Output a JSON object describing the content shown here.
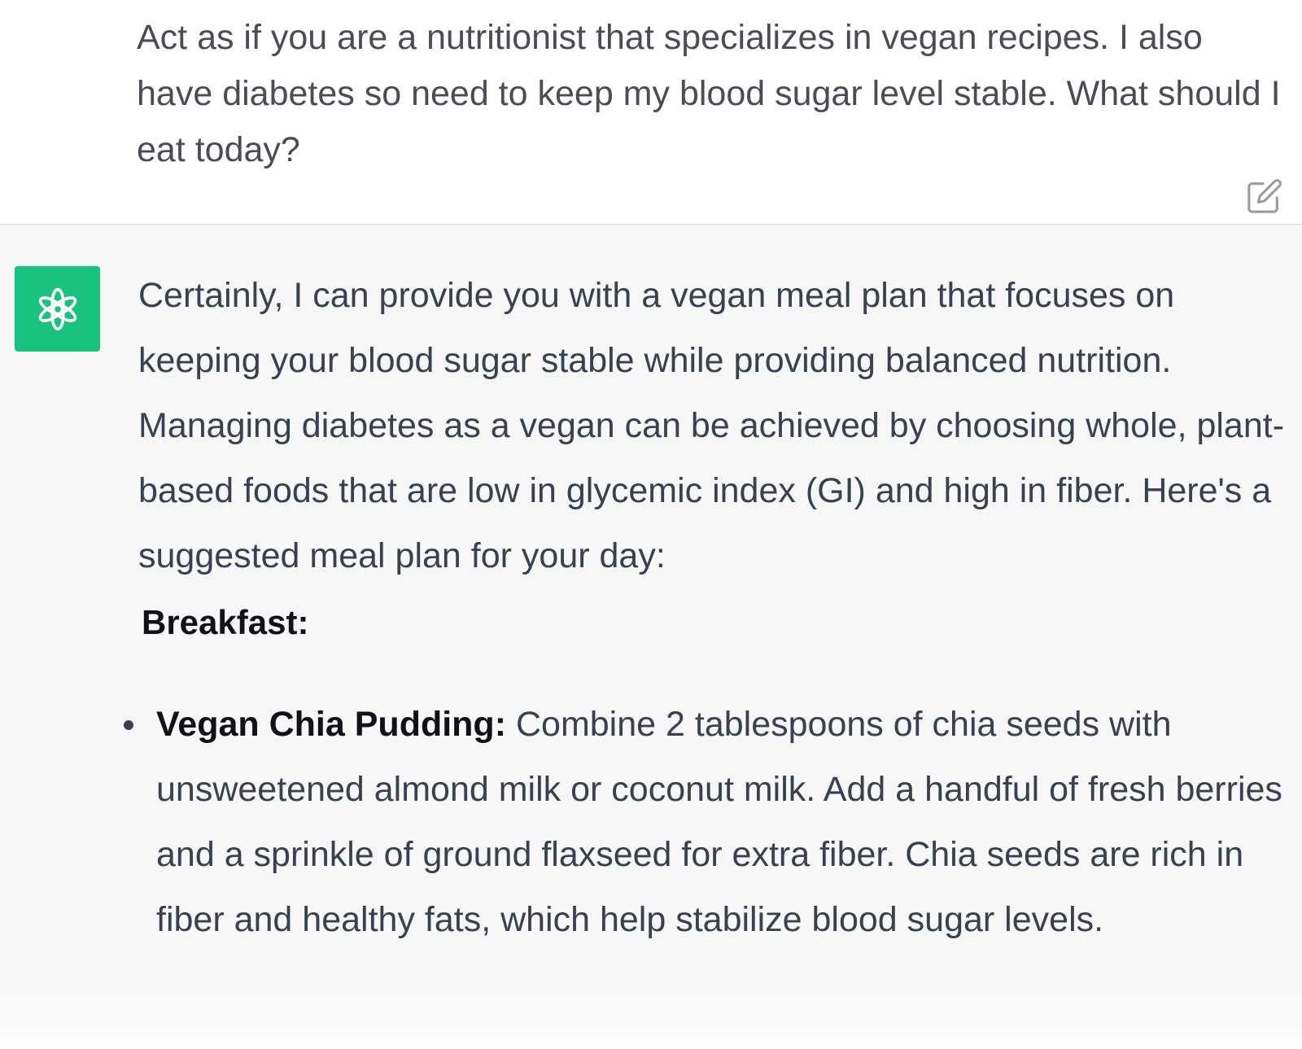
{
  "user_message": {
    "text": "Act as if you are a nutritionist that specializes in vegan recipes. I also have diabetes so need to keep my blood sugar level stable. What should I eat today?",
    "edit_icon": "edit-icon"
  },
  "assistant_message": {
    "avatar_icon": "chatgpt-logo-icon",
    "avatar_color": "#19c37d",
    "intro": "Certainly, I can provide you with a vegan meal plan that focuses on keeping your blood sugar stable while providing balanced nutrition. Managing diabetes as a vegan can be achieved by choosing whole, plant-based foods that are low in glycemic index (GI) and high in fiber. Here's a suggested meal plan for your day:",
    "sections": [
      {
        "heading": "Breakfast:",
        "items": [
          {
            "title": "Vegan Chia Pudding:",
            "text": " Combine 2 tablespoons of chia seeds with unsweetened almond milk or coconut milk. Add a handful of fresh berries and a sprinkle of ground flaxseed for extra fiber. Chia seeds are rich in fiber and healthy fats, which help stabilize blood sugar levels."
          }
        ]
      }
    ]
  }
}
